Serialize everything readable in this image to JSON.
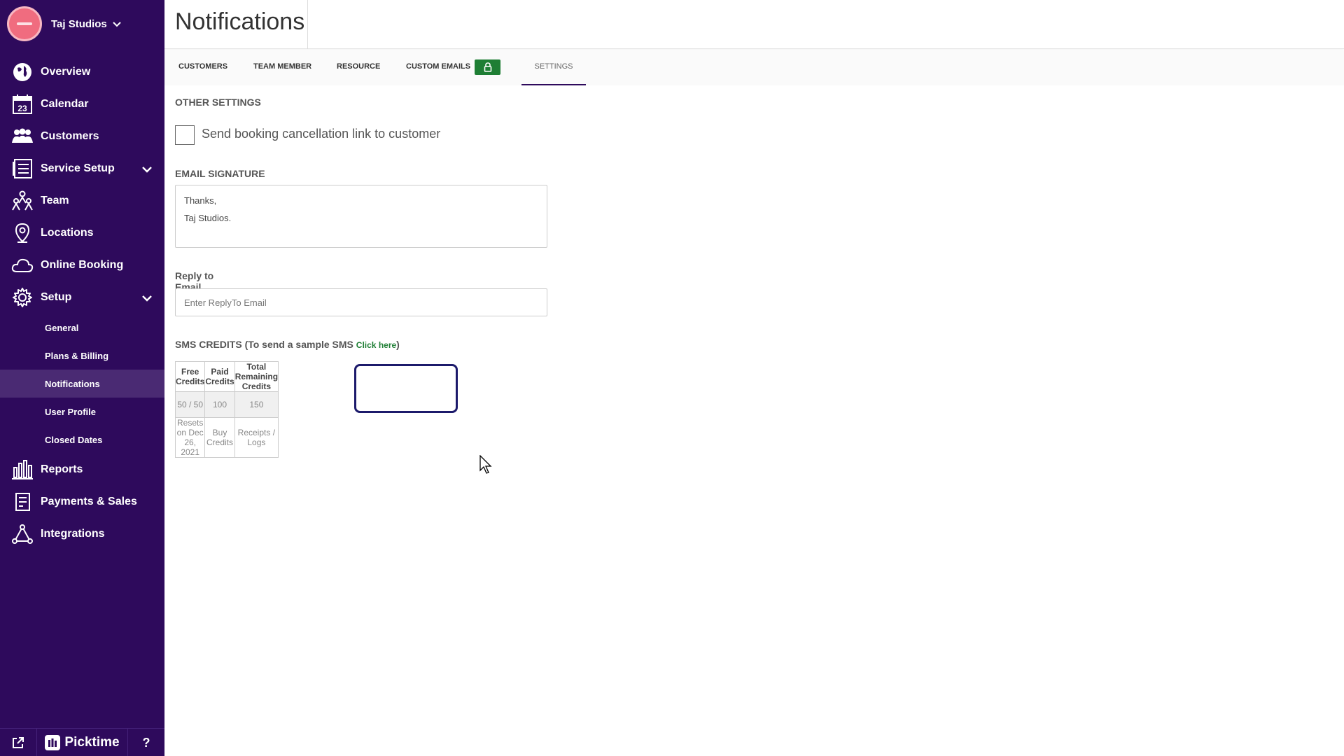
{
  "brand": {
    "name": "Taj Studios"
  },
  "nav": {
    "overview": "Overview",
    "calendar": "Calendar",
    "calendar_day": "23",
    "customers": "Customers",
    "service_setup": "Service Setup",
    "team": "Team",
    "locations": "Locations",
    "online_booking": "Online Booking",
    "setup": "Setup",
    "setup_sub": {
      "general": "General",
      "plans_billing": "Plans & Billing",
      "notifications": "Notifications",
      "user_profile": "User Profile",
      "closed_dates": "Closed Dates"
    },
    "reports": "Reports",
    "payments_sales": "Payments & Sales",
    "integrations": "Integrations"
  },
  "footer": {
    "logo_text": "Picktime",
    "help": "?"
  },
  "header": {
    "title": "Notifications"
  },
  "tabs": {
    "customers": "CUSTOMERS",
    "team_member": "TEAM MEMBER",
    "resource": "RESOURCE",
    "custom_emails": "CUSTOM EMAILS",
    "settings": "SETTINGS"
  },
  "settings": {
    "other_settings_title": "OTHER SETTINGS",
    "cancellation_checkbox_label": "Send booking cancellation link to customer",
    "email_signature_title": "EMAIL SIGNATURE",
    "signature_line1": "Thanks,",
    "signature_line2": "Taj Studios.",
    "reply_label": "Reply to Email Address",
    "reply_placeholder": "Enter ReplyTo Email",
    "sms_title_prefix": "SMS CREDITS (To send a sample SMS ",
    "sms_title_link": "Click here",
    "sms_title_suffix": ")"
  },
  "credits_table": {
    "headers": [
      "Free Credits",
      "Paid Credits",
      "Total Remaining Credits"
    ],
    "values": [
      "50 / 50",
      "100",
      "150"
    ],
    "actions": [
      "Resets on Dec 26, 2021",
      "Buy Credits",
      "Receipts / Logs"
    ]
  },
  "colors": {
    "sidebar": "#2e0a5c",
    "active_sub_item": "#4a2a73",
    "lock_badge": "#1e7e34",
    "highlight_border": "#1c1a6b"
  }
}
